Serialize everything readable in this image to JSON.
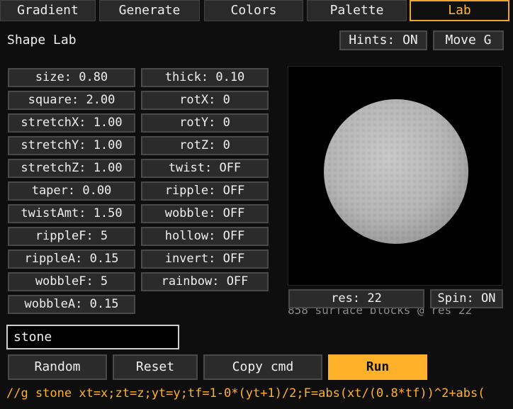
{
  "tabs": [
    {
      "label": "Gradient",
      "active": false
    },
    {
      "label": "Generate",
      "active": false
    },
    {
      "label": "Colors",
      "active": false
    },
    {
      "label": "Palette",
      "active": false
    },
    {
      "label": "Lab",
      "active": true
    }
  ],
  "panel": {
    "title": "Shape Lab",
    "hints_label": "Hints: ON",
    "move_label": "Move G"
  },
  "params_left": [
    "size: 0.80",
    "square: 2.00",
    "stretchX: 1.00",
    "stretchY: 1.00",
    "stretchZ: 1.00",
    "taper: 0.00",
    "twistAmt: 1.50",
    "rippleF: 5",
    "rippleA: 0.15",
    "wobbleF: 5",
    "wobbleA: 0.15"
  ],
  "params_right": [
    "thick: 0.10",
    "rotX: 0",
    "rotY: 0",
    "rotZ: 0",
    "twist: OFF",
    "ripple: OFF",
    "wobble: OFF",
    "hollow: OFF",
    "invert: OFF",
    "rainbow: OFF"
  ],
  "preview": {
    "res_label": "res: 22",
    "spin_label": "Spin: ON",
    "status_text": "858 surface blocks @ res 22",
    "sphere_color": "#b8b8b8"
  },
  "material_input": {
    "value": "stone"
  },
  "actions": {
    "random_label": "Random",
    "reset_label": "Reset",
    "copy_label": "Copy cmd",
    "run_label": "Run"
  },
  "command_text": "//g stone xt=x;zt=z;yt=y;tf=1-0*(yt+1)/2;F=abs(xt/(0.8*tf))^2+abs("
}
